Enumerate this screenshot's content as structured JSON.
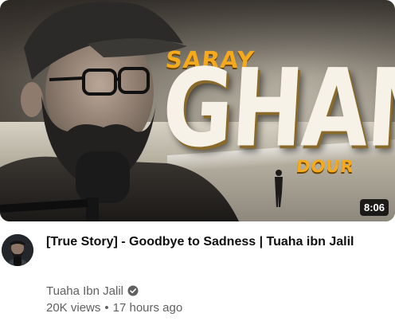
{
  "video": {
    "thumbnail_text": {
      "line1": "SARAY",
      "line2": "GHAM",
      "line3": "DOUR"
    },
    "duration": "8:06",
    "title": "[True Story] - Goodbye to Sadness | Tuaha ibn Jalil",
    "channel": "Tuaha Ibn Jalil",
    "views": "20K views",
    "separator": "•",
    "age": "17 hours ago"
  },
  "colors": {
    "accent_orange": "#f5a91c",
    "title_text": "#0f0f0f",
    "meta_text": "#606060"
  }
}
